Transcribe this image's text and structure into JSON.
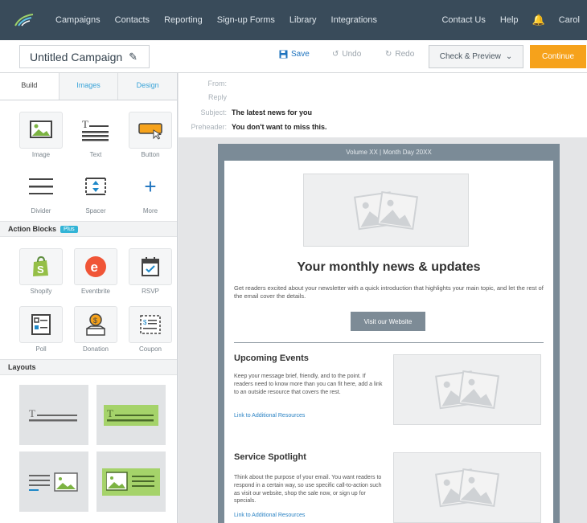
{
  "nav": {
    "items": [
      "Campaigns",
      "Contacts",
      "Reporting",
      "Sign-up Forms",
      "Library",
      "Integrations"
    ],
    "right_items": [
      "Contact Us",
      "Help"
    ],
    "user": "Carol"
  },
  "toolbar": {
    "campaign_name": "Untitled Campaign",
    "save": "Save",
    "undo": "Undo",
    "redo": "Redo",
    "check_preview": "Check & Preview",
    "continue": "Continue"
  },
  "panel": {
    "tabs": [
      "Build",
      "Images",
      "Design"
    ],
    "blocks": [
      "Image",
      "Text",
      "Button",
      "Divider",
      "Spacer",
      "More"
    ],
    "action_blocks_title": "Action Blocks",
    "plus_badge": "Plus",
    "actions": [
      "Shopify",
      "Eventbrite",
      "RSVP",
      "Poll",
      "Donation",
      "Coupon"
    ],
    "layouts_title": "Layouts"
  },
  "header": {
    "from_label": "From:",
    "reply_label": "Reply",
    "subject_label": "Subject:",
    "subject": "The latest news for you",
    "preheader_label": "Preheader:",
    "preheader": "You don't want to miss this."
  },
  "email": {
    "volume": "Volume XX | Month Day 20XX",
    "headline": "Your monthly news & updates",
    "intro": "Get readers excited about your newsletter with a quick introduction that highlights your main topic, and let the rest of the email cover the details.",
    "visit_button": "Visit our Website",
    "sections": [
      {
        "title": "Upcoming Events",
        "text": "Keep your message brief, friendly, and to the point. If readers need to know more than you can fit here, add a link to an outside resource that covers the rest.",
        "link": "Link to Additional Resources"
      },
      {
        "title": "Service Spotlight",
        "text": "Think about the purpose of your email. You want readers to respond in a certain way, so use specific call-to-action such as visit our website, shop the sale now, or sign up for specials.",
        "link": "Link to Additional Resources"
      }
    ]
  },
  "colors": {
    "nav_bg": "#394b5a",
    "continue": "#f6a21b",
    "link": "#2b83c4",
    "email_frame": "#7b8b97"
  }
}
